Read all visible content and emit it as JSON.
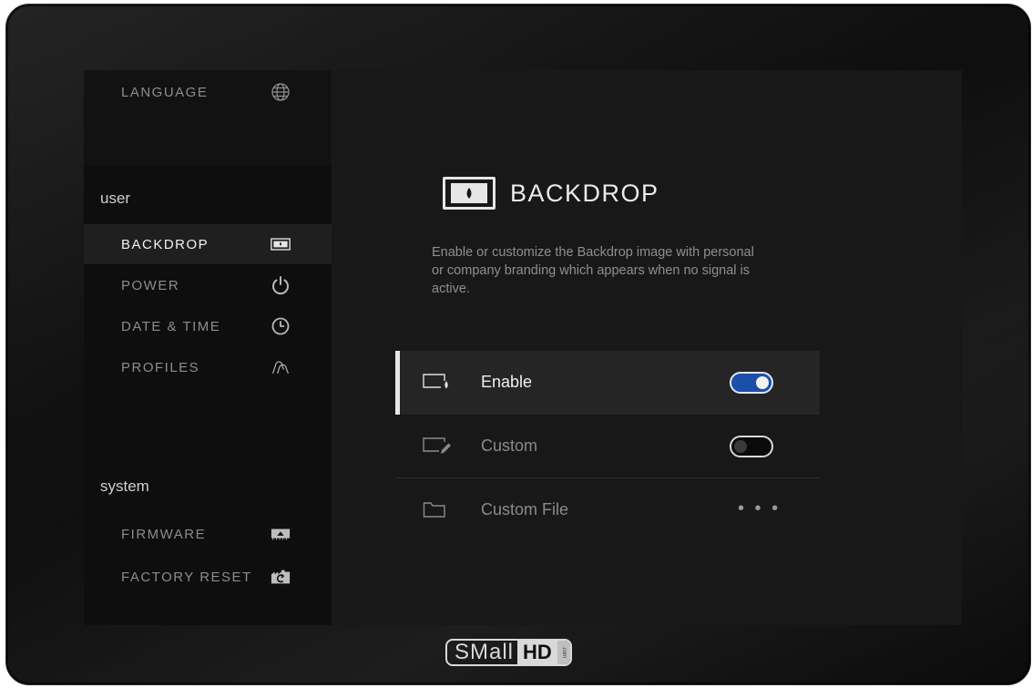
{
  "sidebar": {
    "language": {
      "label": "LANGUAGE",
      "icon": "globe-icon"
    },
    "user_section": "user",
    "system_section": "system",
    "user_items": [
      {
        "label": "BACKDROP",
        "icon": "backdrop-icon",
        "active": true
      },
      {
        "label": "POWER",
        "icon": "power-icon",
        "active": false
      },
      {
        "label": "DATE & TIME",
        "icon": "clock-icon",
        "active": false
      },
      {
        "label": "PROFILES",
        "icon": "profiles-icon",
        "active": false
      }
    ],
    "system_items": [
      {
        "label": "FIRMWARE",
        "icon": "firmware-icon"
      },
      {
        "label": "FACTORY RESET",
        "icon": "factory-reset-icon"
      }
    ]
  },
  "main": {
    "title": "BACKDROP",
    "title_icon": "backdrop-icon",
    "description": "Enable or customize the Backdrop image with personal or company branding which appears when no signal is active.",
    "settings": [
      {
        "label": "Enable",
        "icon": "enable-backdrop-icon",
        "control": "toggle",
        "value": true,
        "selected": true
      },
      {
        "label": "Custom",
        "icon": "custom-edit-icon",
        "control": "toggle",
        "value": false,
        "selected": false
      },
      {
        "label": "Custom File",
        "icon": "folder-icon",
        "control": "more",
        "value_text": "• • •",
        "selected": false
      }
    ]
  },
  "brand": {
    "small": "SMall",
    "hd": "HD",
    "com": ".com"
  },
  "colors": {
    "accent": "#1b4fa8",
    "active_text": "#f2f2f2",
    "inactive_text": "#8c8c8c"
  }
}
